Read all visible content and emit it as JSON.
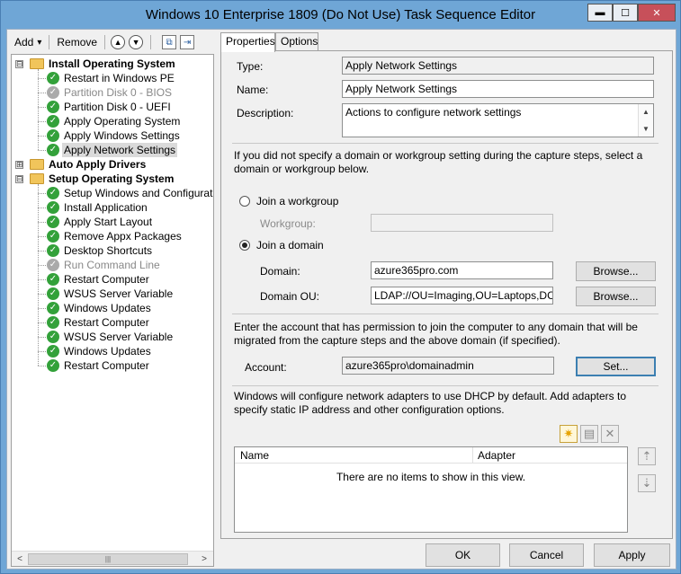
{
  "window": {
    "title": "Windows 10 Enterprise 1809 (Do Not Use) Task Sequence Editor",
    "min_glyph": "▬",
    "max_glyph": "☐",
    "close_glyph": "✕"
  },
  "toolbar": {
    "add_label": "Add",
    "add_caret": "▾",
    "remove_label": "Remove"
  },
  "tree": {
    "groups": [
      {
        "label": "Install Operating System",
        "expander": "⊟",
        "steps": [
          {
            "label": "Restart in Windows PE",
            "enabled": true
          },
          {
            "label": "Partition Disk 0 - BIOS",
            "enabled": false
          },
          {
            "label": "Partition Disk 0 - UEFI",
            "enabled": true
          },
          {
            "label": "Apply Operating System",
            "enabled": true
          },
          {
            "label": "Apply Windows Settings",
            "enabled": true
          },
          {
            "label": "Apply Network Settings",
            "enabled": true,
            "selected": true
          }
        ]
      },
      {
        "label": "Auto Apply Drivers",
        "expander": "⊞",
        "steps": []
      },
      {
        "label": "Setup Operating System",
        "expander": "⊟",
        "steps": [
          {
            "label": "Setup Windows and Configuration",
            "enabled": true
          },
          {
            "label": "Install Application",
            "enabled": true
          },
          {
            "label": "Apply Start Layout",
            "enabled": true
          },
          {
            "label": "Remove Appx Packages",
            "enabled": true
          },
          {
            "label": "Desktop Shortcuts",
            "enabled": true
          },
          {
            "label": "Run Command Line",
            "enabled": false
          },
          {
            "label": "Restart Computer",
            "enabled": true
          },
          {
            "label": "WSUS Server Variable",
            "enabled": true
          },
          {
            "label": "Windows Updates",
            "enabled": true
          },
          {
            "label": "Restart Computer",
            "enabled": true
          },
          {
            "label": "WSUS Server Variable",
            "enabled": true
          },
          {
            "label": "Windows Updates",
            "enabled": true
          },
          {
            "label": "Restart Computer",
            "enabled": true
          }
        ]
      }
    ]
  },
  "tabs": [
    {
      "label": "Properties",
      "active": true
    },
    {
      "label": "Options",
      "active": false
    }
  ],
  "properties": {
    "type_label": "Type:",
    "type_value": "Apply Network Settings",
    "name_label": "Name:",
    "name_value": "Apply Network Settings",
    "description_label": "Description:",
    "description_value": "Actions to configure network settings",
    "domain_intro": "If you did not specify a domain or workgroup setting during the capture steps, select a domain or workgroup below.",
    "join_workgroup_label": "Join a workgroup",
    "workgroup_label": "Workgroup:",
    "workgroup_value": "",
    "join_domain_label": "Join a domain",
    "join_domain_selected": true,
    "domain_label": "Domain:",
    "domain_value": "azure365pro.com",
    "domain_ou_label": "Domain OU:",
    "domain_ou_value": "LDAP://OU=Imaging,OU=Laptops,DC=azi",
    "browse_label": "Browse...",
    "account_intro": "Enter the account that has permission to join the computer to any domain that will be migrated from the capture steps and the above domain (if specified).",
    "account_label": "Account:",
    "account_value": "azure365pro\\domainadmin",
    "set_label": "Set...",
    "adapters_intro": "Windows will configure network adapters to use DHCP by default. Add adapters to specify static IP address and other configuration options.",
    "adapters_columns": [
      "Name",
      "Adapter"
    ],
    "adapters_empty": "There are no items to show in this view."
  },
  "footer": {
    "ok_label": "OK",
    "cancel_label": "Cancel",
    "apply_label": "Apply"
  }
}
